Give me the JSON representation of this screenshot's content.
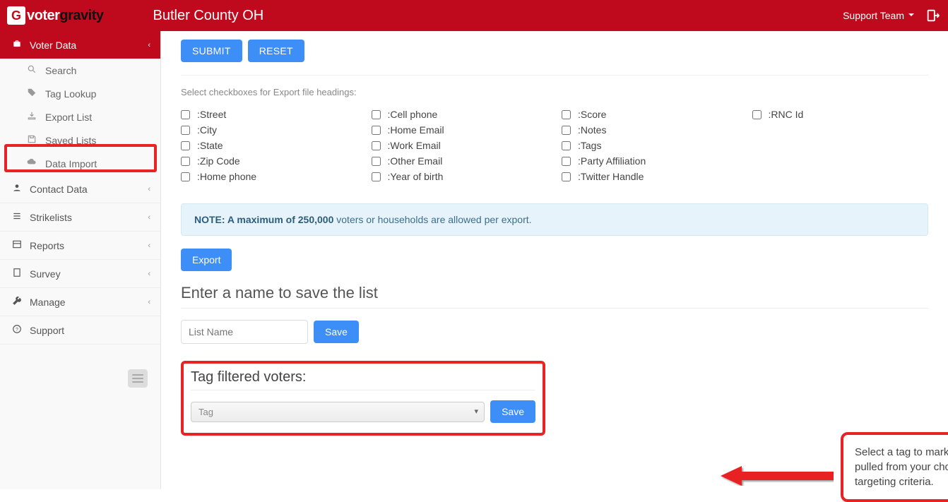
{
  "logo": {
    "badge": "G",
    "text1": "voter",
    "text2": "gravity"
  },
  "county": "Butler County OH",
  "user_menu": "Support Team",
  "sidebar": {
    "voter_data": "Voter Data",
    "search": "Search",
    "tag_lookup": "Tag Lookup",
    "export_list": "Export List",
    "saved_lists": "Saved Lists",
    "data_import": "Data Import",
    "contact_data": "Contact Data",
    "strikelists": "Strikelists",
    "reports": "Reports",
    "survey": "Survey",
    "manage": "Manage",
    "support": "Support"
  },
  "buttons": {
    "submit": "SUBMIT",
    "reset": "RESET",
    "export": "Export",
    "save1": "Save",
    "save2": "Save"
  },
  "hint": "Select checkboxes for Export file headings:",
  "checkboxes": {
    "c1": ":Street",
    "c2": ":City",
    "c3": ":State",
    "c4": ":Zip Code",
    "c5": ":Home phone",
    "c6": ":Cell phone",
    "c7": ":Home Email",
    "c8": ":Work Email",
    "c9": ":Other Email",
    "c10": ":Year of birth",
    "c11": ":Score",
    "c12": ":Notes",
    "c13": ":Tags",
    "c14": ":Party Affiliation",
    "c15": ":Twitter Handle",
    "c16": ":RNC Id"
  },
  "note": {
    "bold": "NOTE: A maximum of 250,000",
    "rest": " voters or households are allowed per export."
  },
  "save_list": {
    "title": "Enter a name to save the list",
    "placeholder": "List Name"
  },
  "tag_section": {
    "title": "Tag filtered voters:",
    "placeholder": "Tag"
  },
  "annotation": "Select a tag to mark all voters pulled from your chosen targeting criteria."
}
